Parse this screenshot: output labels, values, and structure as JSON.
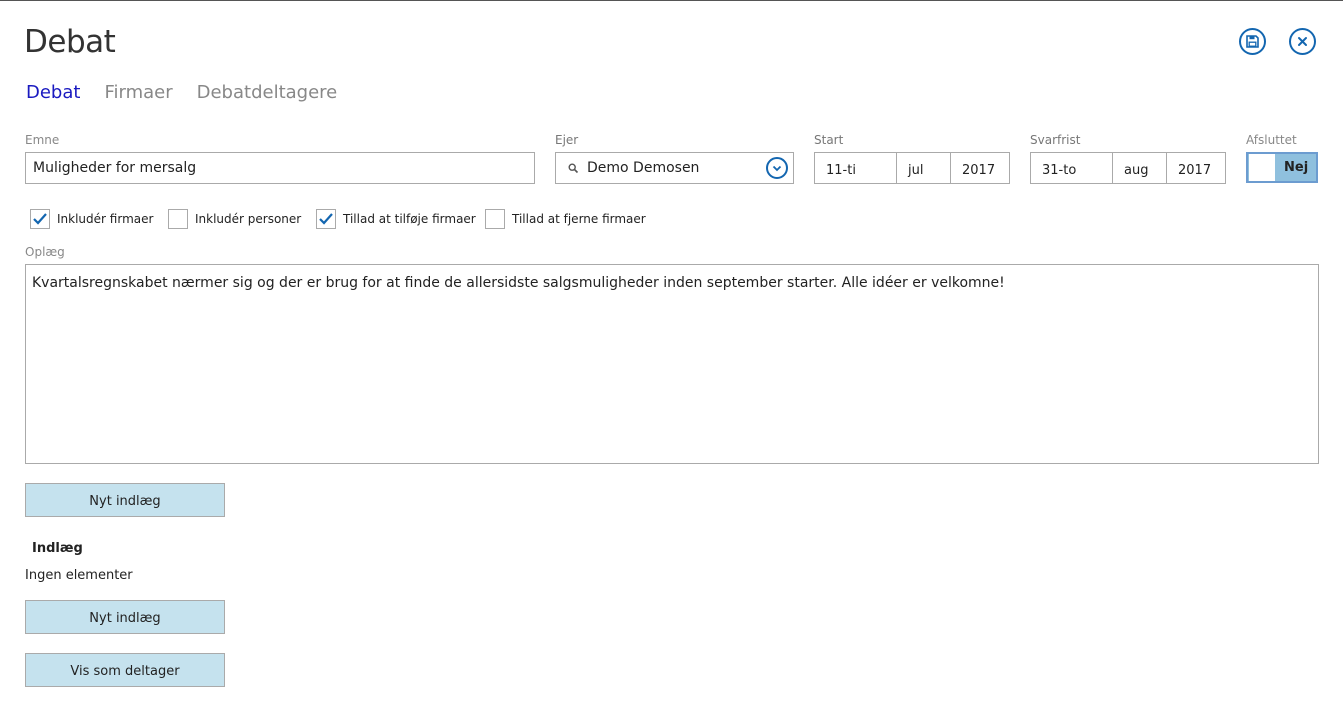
{
  "header": {
    "title": "Debat",
    "save_icon": "save-icon",
    "close_icon": "close-icon",
    "accent": "#1366b0"
  },
  "tabs": [
    {
      "label": "Debat",
      "active": true
    },
    {
      "label": "Firmaer",
      "active": false
    },
    {
      "label": "Debatdeltagere",
      "active": false
    }
  ],
  "form": {
    "emne": {
      "label": "Emne",
      "value": "Muligheder for mersalg"
    },
    "ejer": {
      "label": "Ejer",
      "value": "Demo Demosen",
      "search_icon": "search-icon",
      "dropdown_icon": "chevron-down-icon"
    },
    "start": {
      "label": "Start",
      "day": "11-ti",
      "month": "jul",
      "year": "2017"
    },
    "svarfrist": {
      "label": "Svarfrist",
      "day": "31-to",
      "month": "aug",
      "year": "2017"
    },
    "afsluttet": {
      "label": "Afsluttet",
      "value": "Nej"
    }
  },
  "checkboxes": [
    {
      "label": "Inkludér firmaer",
      "checked": true
    },
    {
      "label": "Inkludér personer",
      "checked": false
    },
    {
      "label": "Tillad at tilføje firmaer",
      "checked": true
    },
    {
      "label": "Tillad at fjerne firmaer",
      "checked": false
    }
  ],
  "oplaeg": {
    "label": "Oplæg",
    "value": "Kvartalsregnskabet nærmer sig og der er brug for at finde de allersidste salgsmuligheder inden september starter. Alle idéer er velkomne!"
  },
  "buttons": {
    "nyt_indlaeg_top": "Nyt indlæg",
    "nyt_indlaeg_bottom": "Nyt indlæg",
    "vis_som_deltager": "Vis som deltager"
  },
  "indlaeg": {
    "heading": "Indlæg",
    "empty_text": "Ingen elementer"
  }
}
